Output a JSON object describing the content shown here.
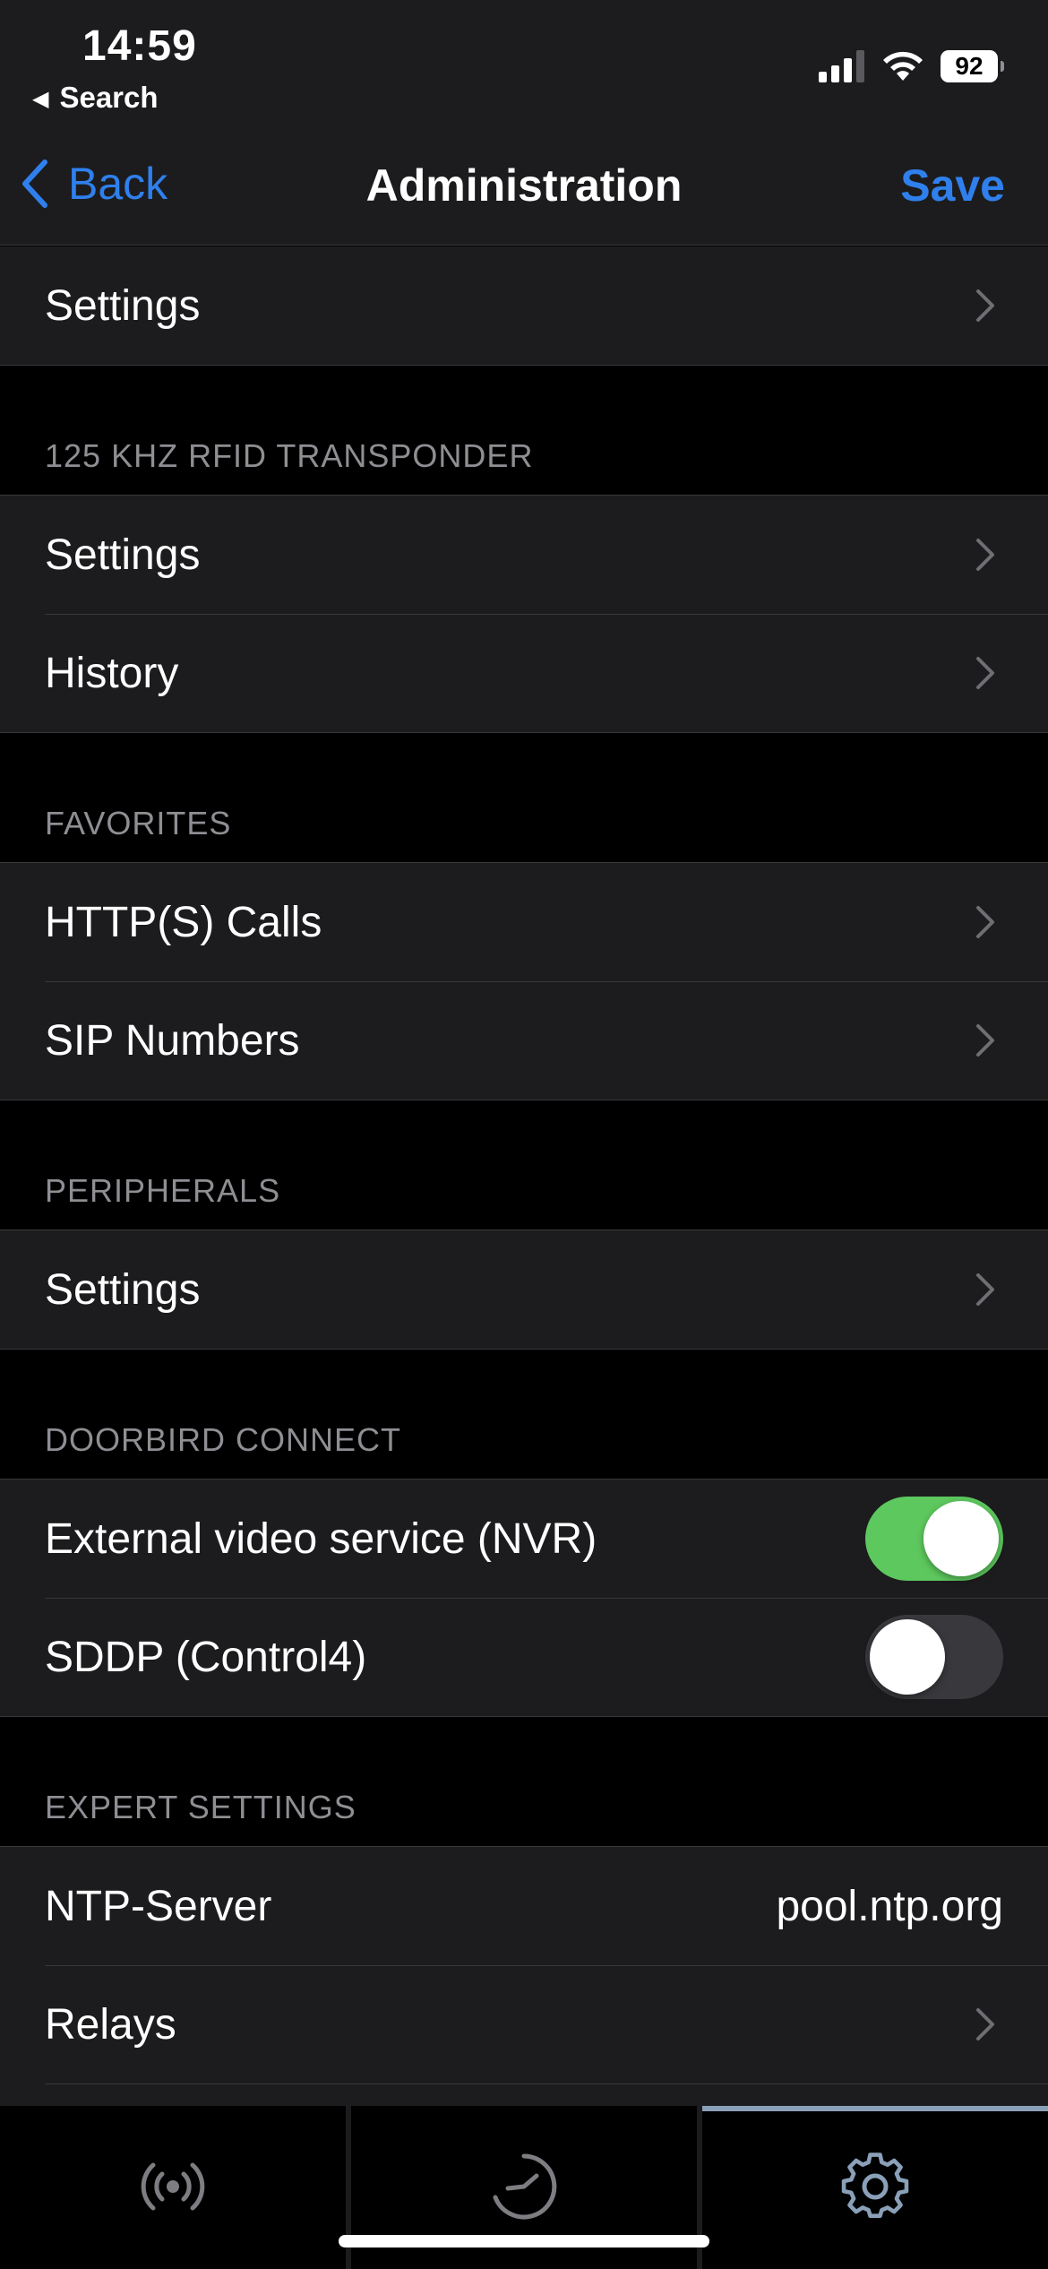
{
  "status_bar": {
    "time": "14:59",
    "back_app": "Search",
    "battery": "92"
  },
  "nav": {
    "back_label": "Back",
    "title": "Administration",
    "save_label": "Save"
  },
  "top_group": {
    "item": "Settings"
  },
  "rfid": {
    "header": "125 KHZ RFID TRANSPONDER",
    "items": [
      "Settings",
      "History"
    ]
  },
  "favorites": {
    "header": "FAVORITES",
    "items": [
      "HTTP(S) Calls",
      "SIP Numbers"
    ]
  },
  "peripherals": {
    "header": "PERIPHERALS",
    "items": [
      "Settings"
    ]
  },
  "doorbird_connect": {
    "header": "DOORBIRD CONNECT",
    "nvr_label": "External video service (NVR)",
    "nvr_on": true,
    "sddp_label": "SDDP (Control4)",
    "sddp_on": false
  },
  "expert": {
    "header": "EXPERT SETTINGS",
    "ntp_label": "NTP-Server",
    "ntp_value": "pool.ntp.org",
    "relays_label": "Relays"
  },
  "tabs": [
    {
      "icon": "broadcast-icon",
      "active": false
    },
    {
      "icon": "history-clock-icon",
      "active": false
    },
    {
      "icon": "gear-icon",
      "active": true
    }
  ],
  "colors": {
    "accent": "#2f80ed",
    "toggle_on": "#5dc85d",
    "background": "#000000",
    "cell": "#1c1c1e",
    "secondary_text": "#8e8e93"
  }
}
